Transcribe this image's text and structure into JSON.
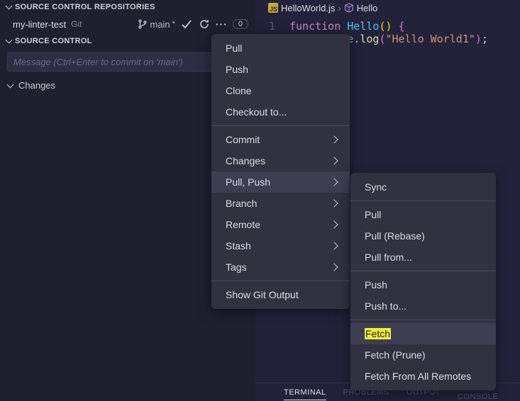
{
  "sidebar": {
    "repos_header": "SOURCE CONTROL REPOSITORIES",
    "repo_name": "my-linter-test",
    "repo_type": "Git",
    "branch": "main",
    "sync_indicator": "*",
    "badge_count": "0",
    "sc_header": "SOURCE CONTROL",
    "message_placeholder": "Message (Ctrl+Enter to commit on 'main')",
    "changes_label": "Changes"
  },
  "editor": {
    "file_name": "HelloWorld.js",
    "crumb_symbol": "Hello",
    "line_num": "1",
    "kw_function": "function",
    "fn_name": "Hello",
    "obj_name": "onsole",
    "method_name": "log",
    "string_lit": "\"Hello World1\""
  },
  "bottom": {
    "terminal": "TERMINAL",
    "problems": "PROBLEMS",
    "output": "OUTPUT",
    "debug": "DEBUG CONSOLE"
  },
  "menu": {
    "pull": "Pull",
    "push": "Push",
    "clone": "Clone",
    "checkout": "Checkout to...",
    "commit": "Commit",
    "changes": "Changes",
    "pull_push": "Pull, Push",
    "branch": "Branch",
    "remote": "Remote",
    "stash": "Stash",
    "tags": "Tags",
    "show_output": "Show Git Output"
  },
  "submenu": {
    "sync": "Sync",
    "pull": "Pull",
    "pull_rebase": "Pull (Rebase)",
    "pull_from": "Pull from...",
    "push": "Push",
    "push_to": "Push to...",
    "fetch": "Fetch",
    "fetch_prune": "Fetch (Prune)",
    "fetch_all": "Fetch From All Remotes"
  }
}
